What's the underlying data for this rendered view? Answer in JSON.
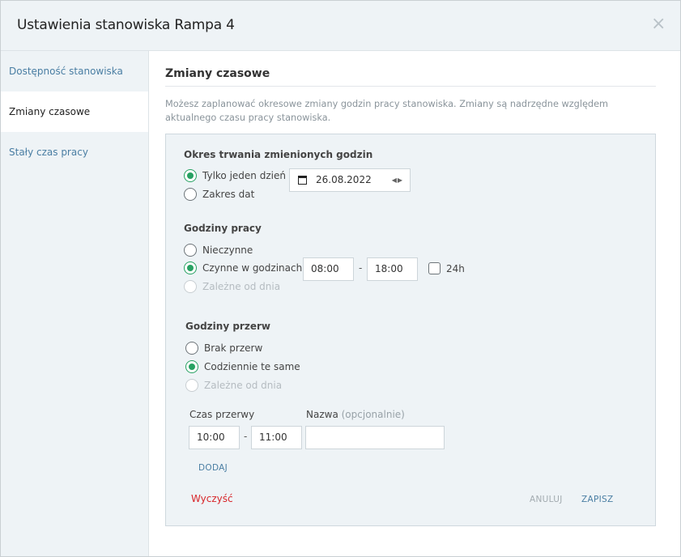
{
  "header": {
    "title": "Ustawienia stanowiska Rampa 4",
    "close_symbol": "×"
  },
  "sidebar": {
    "items": [
      {
        "label": "Dostępność stanowiska",
        "active": false
      },
      {
        "label": "Zmiany czasowe",
        "active": true
      },
      {
        "label": "Stały czas pracy",
        "active": false
      }
    ]
  },
  "main": {
    "title": "Zmiany czasowe",
    "description": "Możesz zaplanować okresowe zmiany godzin pracy stanowiska. Zmiany są nadrzędne względem aktualnego czasu pracy stanowiska.",
    "duration": {
      "title": "Okres trwania zmienionych godzin",
      "options": [
        "Tylko jeden dzień",
        "Zakres dat"
      ],
      "selected": "Tylko jeden dzień",
      "date_value": "26.08.2022"
    },
    "work_hours": {
      "title": "Godziny pracy",
      "options": [
        "Nieczynne",
        "Czynne w godzinach",
        "Zależne od dnia"
      ],
      "selected": "Czynne w godzinach",
      "disabled": [
        "Zależne od dnia"
      ],
      "from": "08:00",
      "separator": "-",
      "to": "18:00",
      "checkbox_24h": {
        "label": "24h",
        "checked": false
      }
    },
    "breaks": {
      "title": "Godziny przerw",
      "options": [
        "Brak przerw",
        "Codziennie te same",
        "Zależne od dnia"
      ],
      "selected": "Codziennie te same",
      "disabled": [
        "Zależne od dnia"
      ],
      "break_time_label": "Czas przerwy",
      "name_label": "Nazwa",
      "name_optional": "(opcjonalnie)",
      "from": "10:00",
      "separator": "-",
      "to": "11:00",
      "name_value": "",
      "add_label": "DODAJ"
    },
    "actions": {
      "clear": "Wyczyść",
      "cancel": "ANULUJ",
      "save": "ZAPISZ"
    }
  },
  "colors": {
    "accent": "#27a162",
    "link": "#4a7ea3",
    "danger": "#d8262a",
    "panel_bg": "#eef3f6"
  }
}
